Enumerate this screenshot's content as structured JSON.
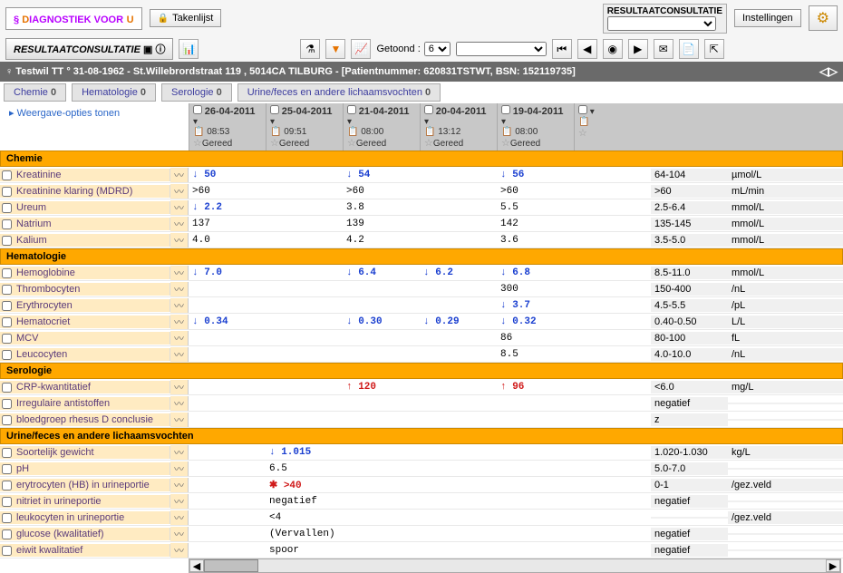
{
  "app": {
    "logo_a": "D",
    "logo_b": "IAGNOSTIEK VOOR",
    "logo_c": "U",
    "takenlijst": "Takenlijst",
    "resconsult_title": "RESULTAATCONSULTATIE",
    "instellingen": "Instellingen"
  },
  "toolbar": {
    "tab": "RESULTAATCONSULTATIE",
    "getoond_label": "Getoond :",
    "getoond_value": "6"
  },
  "patient": {
    "line": "♀ Testwil TT ° 31-08-1962 - St.Willebrordstraat 119 , 5014CA TILBURG - [Patientnummer: 620831TSTWT, BSN: 152119735]"
  },
  "subtabs": [
    {
      "label": "Chemie",
      "n": "0"
    },
    {
      "label": "Hematologie",
      "n": "0"
    },
    {
      "label": "Serologie",
      "n": "0"
    },
    {
      "label": "Urine/feces en andere lichaamsvochten",
      "n": "0"
    }
  ],
  "weergave": "▸ Weergave-opties tonen",
  "columns": [
    {
      "date": "26-04-2011",
      "time": "08:53",
      "status": "Gereed"
    },
    {
      "date": "25-04-2011",
      "time": "09:51",
      "status": "Gereed"
    },
    {
      "date": "21-04-2011",
      "time": "08:00",
      "status": "Gereed"
    },
    {
      "date": "20-04-2011",
      "time": "13:12",
      "status": "Gereed"
    },
    {
      "date": "19-04-2011",
      "time": "08:00",
      "status": "Gereed"
    },
    {
      "date": "",
      "time": "",
      "status": ""
    }
  ],
  "sections": [
    {
      "title": "Chemie",
      "rows": [
        {
          "name": "Kreatinine",
          "vals": [
            {
              "v": "50",
              "c": "blue",
              "a": "down"
            },
            {
              "v": ""
            },
            {
              "v": "54",
              "c": "blue",
              "a": "down"
            },
            {
              "v": ""
            },
            {
              "v": "56",
              "c": "blue",
              "a": "down"
            },
            {
              "v": ""
            }
          ],
          "ref": "64-104",
          "unit": "µmol/L"
        },
        {
          "name": "Kreatinine klaring (MDRD)",
          "vals": [
            {
              "v": ">60"
            },
            {
              "v": ""
            },
            {
              "v": ">60"
            },
            {
              "v": ""
            },
            {
              "v": ">60"
            },
            {
              "v": ""
            }
          ],
          "ref": ">60",
          "unit": "mL/min"
        },
        {
          "name": "Ureum",
          "vals": [
            {
              "v": "2.2",
              "c": "blue",
              "a": "down"
            },
            {
              "v": ""
            },
            {
              "v": "3.8"
            },
            {
              "v": ""
            },
            {
              "v": "5.5"
            },
            {
              "v": ""
            }
          ],
          "ref": "2.5-6.4",
          "unit": "mmol/L"
        },
        {
          "name": "Natrium",
          "vals": [
            {
              "v": "137"
            },
            {
              "v": ""
            },
            {
              "v": "139"
            },
            {
              "v": ""
            },
            {
              "v": "142"
            },
            {
              "v": ""
            }
          ],
          "ref": "135-145",
          "unit": "mmol/L"
        },
        {
          "name": "Kalium",
          "vals": [
            {
              "v": "4.0"
            },
            {
              "v": ""
            },
            {
              "v": "4.2"
            },
            {
              "v": ""
            },
            {
              "v": "3.6"
            },
            {
              "v": ""
            }
          ],
          "ref": "3.5-5.0",
          "unit": "mmol/L"
        }
      ]
    },
    {
      "title": "Hematologie",
      "rows": [
        {
          "name": "Hemoglobine",
          "vals": [
            {
              "v": "7.0",
              "c": "blue",
              "a": "down"
            },
            {
              "v": ""
            },
            {
              "v": "6.4",
              "c": "blue",
              "a": "down"
            },
            {
              "v": "6.2",
              "c": "blue",
              "a": "down"
            },
            {
              "v": "6.8",
              "c": "blue",
              "a": "down"
            },
            {
              "v": ""
            }
          ],
          "ref": "8.5-11.0",
          "unit": "mmol/L"
        },
        {
          "name": "Thrombocyten",
          "vals": [
            {
              "v": ""
            },
            {
              "v": ""
            },
            {
              "v": ""
            },
            {
              "v": ""
            },
            {
              "v": "300"
            },
            {
              "v": ""
            }
          ],
          "ref": "150-400",
          "unit": "/nL"
        },
        {
          "name": "Erythrocyten",
          "vals": [
            {
              "v": ""
            },
            {
              "v": ""
            },
            {
              "v": ""
            },
            {
              "v": ""
            },
            {
              "v": "3.7",
              "c": "blue",
              "a": "down"
            },
            {
              "v": ""
            }
          ],
          "ref": "4.5-5.5",
          "unit": "/pL"
        },
        {
          "name": "Hematocriet",
          "vals": [
            {
              "v": "0.34",
              "c": "blue",
              "a": "down"
            },
            {
              "v": ""
            },
            {
              "v": "0.30",
              "c": "blue",
              "a": "down"
            },
            {
              "v": "0.29",
              "c": "blue",
              "a": "down"
            },
            {
              "v": "0.32",
              "c": "blue",
              "a": "down"
            },
            {
              "v": ""
            }
          ],
          "ref": "0.40-0.50",
          "unit": "L/L"
        },
        {
          "name": "MCV",
          "vals": [
            {
              "v": ""
            },
            {
              "v": ""
            },
            {
              "v": ""
            },
            {
              "v": ""
            },
            {
              "v": "86"
            },
            {
              "v": ""
            }
          ],
          "ref": "80-100",
          "unit": "fL"
        },
        {
          "name": "Leucocyten",
          "vals": [
            {
              "v": ""
            },
            {
              "v": ""
            },
            {
              "v": ""
            },
            {
              "v": ""
            },
            {
              "v": "8.5"
            },
            {
              "v": ""
            }
          ],
          "ref": "4.0-10.0",
          "unit": "/nL"
        }
      ]
    },
    {
      "title": "Serologie",
      "rows": [
        {
          "name": "CRP-kwantitatief",
          "vals": [
            {
              "v": ""
            },
            {
              "v": ""
            },
            {
              "v": "120",
              "c": "red",
              "a": "up"
            },
            {
              "v": ""
            },
            {
              "v": "96",
              "c": "red",
              "a": "up"
            },
            {
              "v": ""
            }
          ],
          "ref": "<6.0",
          "unit": "mg/L"
        },
        {
          "name": "Irregulaire antistoffen",
          "vals": [
            {
              "v": ""
            },
            {
              "v": ""
            },
            {
              "v": ""
            },
            {
              "v": ""
            },
            {
              "v": ""
            },
            {
              "v": ""
            }
          ],
          "ref": "negatief",
          "unit": ""
        },
        {
          "name": "bloedgroep rhesus D conclusie",
          "vals": [
            {
              "v": ""
            },
            {
              "v": ""
            },
            {
              "v": ""
            },
            {
              "v": ""
            },
            {
              "v": ""
            },
            {
              "v": ""
            }
          ],
          "ref": "z",
          "unit": ""
        }
      ]
    },
    {
      "title": "Urine/feces en andere lichaamsvochten",
      "rows": [
        {
          "name": "Soortelijk gewicht",
          "vals": [
            {
              "v": ""
            },
            {
              "v": "1.015",
              "c": "blue",
              "a": "down"
            },
            {
              "v": ""
            },
            {
              "v": ""
            },
            {
              "v": ""
            },
            {
              "v": ""
            }
          ],
          "ref": "1.020-1.030",
          "unit": "kg/L"
        },
        {
          "name": "pH",
          "vals": [
            {
              "v": ""
            },
            {
              "v": "6.5"
            },
            {
              "v": ""
            },
            {
              "v": ""
            },
            {
              "v": ""
            },
            {
              "v": ""
            }
          ],
          "ref": "5.0-7.0",
          "unit": ""
        },
        {
          "name": "erytrocyten (HB) in urineportie",
          "vals": [
            {
              "v": ""
            },
            {
              "v": ">40",
              "c": "red",
              "a": "ast"
            },
            {
              "v": ""
            },
            {
              "v": ""
            },
            {
              "v": ""
            },
            {
              "v": ""
            }
          ],
          "ref": "0-1",
          "unit": "/gez.veld"
        },
        {
          "name": "nitriet in urineportie",
          "vals": [
            {
              "v": ""
            },
            {
              "v": "negatief"
            },
            {
              "v": ""
            },
            {
              "v": ""
            },
            {
              "v": ""
            },
            {
              "v": ""
            }
          ],
          "ref": "negatief",
          "unit": ""
        },
        {
          "name": "leukocyten in urineportie",
          "vals": [
            {
              "v": ""
            },
            {
              "v": "<4"
            },
            {
              "v": ""
            },
            {
              "v": ""
            },
            {
              "v": ""
            },
            {
              "v": ""
            }
          ],
          "ref": "",
          "unit": "/gez.veld"
        },
        {
          "name": "glucose (kwalitatief)",
          "vals": [
            {
              "v": ""
            },
            {
              "v": "(Vervallen)"
            },
            {
              "v": ""
            },
            {
              "v": ""
            },
            {
              "v": ""
            },
            {
              "v": ""
            }
          ],
          "ref": "negatief",
          "unit": ""
        },
        {
          "name": "eiwit kwalitatief",
          "vals": [
            {
              "v": ""
            },
            {
              "v": "spoor"
            },
            {
              "v": ""
            },
            {
              "v": ""
            },
            {
              "v": ""
            },
            {
              "v": ""
            }
          ],
          "ref": "negatief",
          "unit": ""
        }
      ]
    }
  ]
}
